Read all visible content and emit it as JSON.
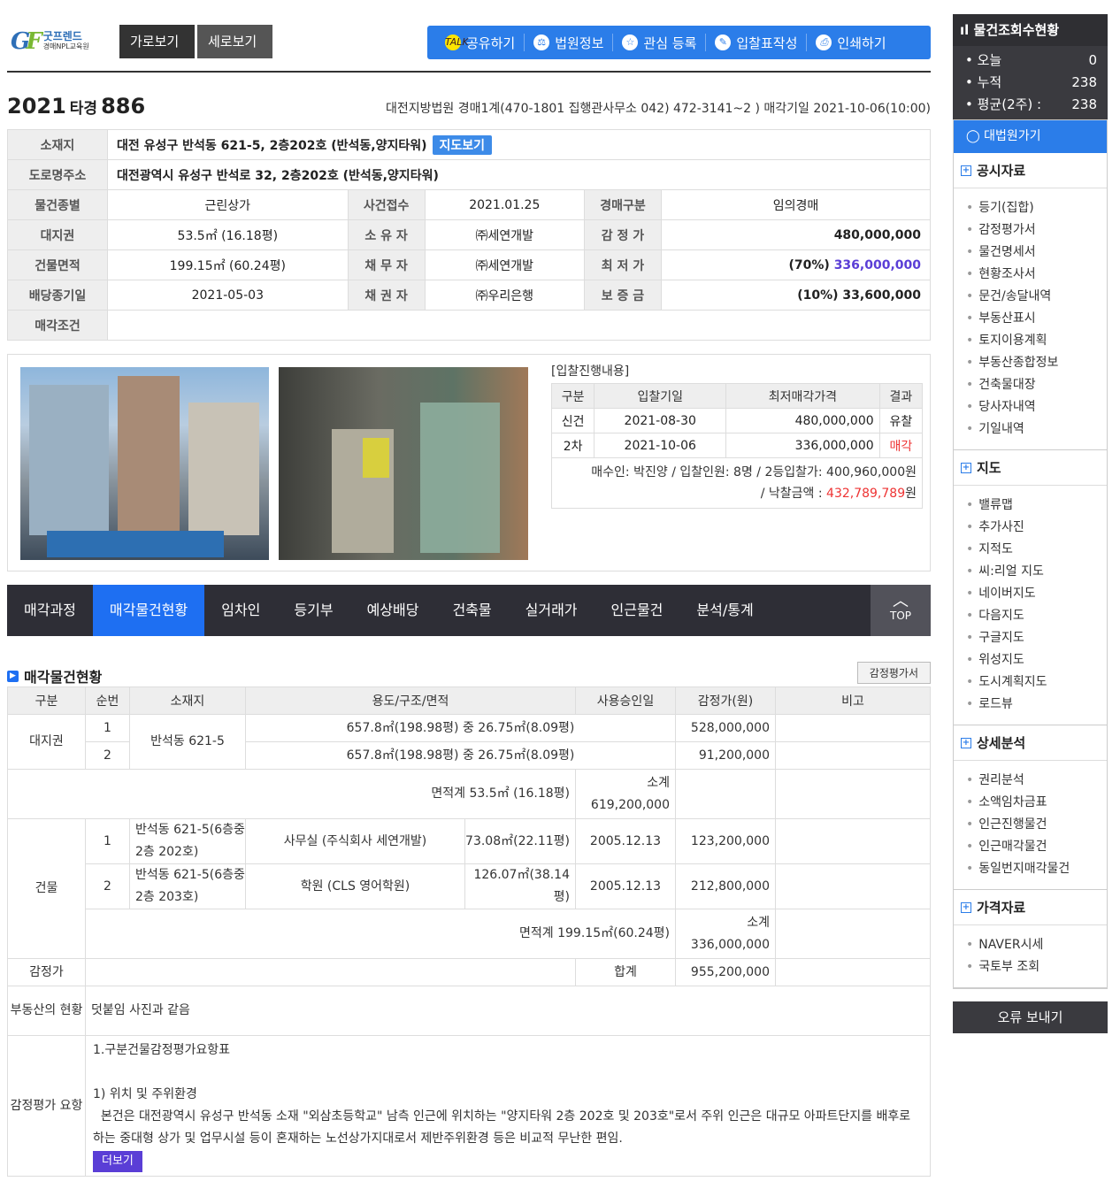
{
  "logo": {
    "brand": "굿프렌드",
    "sub": "경매NPL교육원"
  },
  "view": {
    "horizontal": "가로보기",
    "vertical": "세로보기"
  },
  "toolbar": [
    {
      "icon": "kakao-icon",
      "label": "공유하기"
    },
    {
      "icon": "court-icon",
      "label": "법원정보"
    },
    {
      "icon": "star-icon",
      "label": "관심 등록"
    },
    {
      "icon": "document-icon",
      "label": "입찰표작성"
    },
    {
      "icon": "printer-icon",
      "label": "인쇄하기"
    }
  ],
  "case": {
    "year": "2021",
    "type": "타경",
    "num": "886",
    "court": "대전지방법원 경매1계(470-1801 집행관사무소  042) 472-3141~2 ) 매각기일 2021-10-06(10:00)"
  },
  "info": {
    "addr_label": "소재지",
    "addr": "대전 유성구 반석동 621-5, 2층202호 (반석동,양지타워)",
    "map_btn": "지도보기",
    "road_label": "도로명주소",
    "road": "대전광역시 유성구 반석로 32, 2층202호 (반석동,양지타워)",
    "rows": [
      [
        "물건종별",
        "근린상가",
        "사건접수",
        "2021.01.25",
        "경매구분",
        "임의경매"
      ],
      [
        "대지권",
        "53.5㎡ (16.18평)",
        "소 유 자",
        "㈜세연개발",
        "감 정 가",
        "480,000,000"
      ],
      [
        "건물면적",
        "199.15㎡ (60.24평)",
        "채 무 자",
        "㈜세연개발",
        "최 저 가",
        ""
      ],
      [
        "배당종기일",
        "2021-05-03",
        "채 권 자",
        "㈜우리은행",
        "보 증 금",
        "(10%) 33,600,000"
      ]
    ],
    "min_pct": "(70%)",
    "min_val": "336,000,000",
    "cond_label": "매각조건",
    "cond": ""
  },
  "bid": {
    "title": "[입찰진행내용]",
    "headers": [
      "구분",
      "입찰기일",
      "최저매각가격",
      "결과"
    ],
    "rows": [
      [
        "신건",
        "2021-08-30",
        "480,000,000",
        "유찰"
      ],
      [
        "2차",
        "2021-10-06",
        "336,000,000",
        "매각"
      ]
    ],
    "summary1": "매수인: 박진양 / 입찰인원: 8명 / 2등입찰가: 400,960,000원",
    "summary2a": "/ 낙찰금액 : ",
    "summary2b": "432,789,789",
    "summary2c": "원"
  },
  "tabs": [
    "매각과정",
    "매각물건현황",
    "임차인",
    "등기부",
    "예상배당",
    "건축물",
    "실거래가",
    "인근물건",
    "분석/통계"
  ],
  "top_label": "TOP",
  "items": {
    "title": "매각물건현황",
    "appraisal_btn": "감정평가서",
    "headers": [
      "구분",
      "순번",
      "소재지",
      "용도/구조/면적",
      "사용승인일",
      "감정가(원)",
      "비고"
    ],
    "land_label": "대지권",
    "land_loc": "반석동 621-5",
    "land_rows": [
      [
        "1",
        "657.8㎡(198.98평) 중 26.75㎡(8.09평)",
        "528,000,000"
      ],
      [
        "2",
        "657.8㎡(198.98평) 중 26.75㎡(8.09평)",
        "91,200,000"
      ]
    ],
    "land_total": "면적계 53.5㎡ (16.18평)",
    "land_sub": "소계 619,200,000",
    "bldg_label": "건물",
    "bldg_rows": [
      [
        "1",
        "반석동 621-5(6층중2층 202호)",
        "사무실 (주식회사 세연개발)",
        "73.08㎡(22.11평)",
        "2005.12.13",
        "123,200,000"
      ],
      [
        "2",
        "반석동 621-5(6층중2층 203호)",
        "학원 (CLS 영어학원)",
        "126.07㎡(38.14평)",
        "2005.12.13",
        "212,800,000"
      ]
    ],
    "bldg_total": "면적계 199.15㎡(60.24평)",
    "bldg_sub": "소계 336,000,000",
    "appr_label": "감정가",
    "sum_label": "합계",
    "sum": "955,200,000",
    "status_label": "부동산의 현황",
    "status": "덧붙임 사진과 같음",
    "summary_label": "감정평가 요항",
    "summary_l1": "1.구분건물감정평가요항표",
    "summary_l2": "1) 위치 및 주위환경",
    "summary_l3": "  본건은 대전광역시 유성구 반석동 소재 \"외삼초등학교\" 남측 인근에 위치하는 \"양지타워 2층 202호 및 203호\"로서 주위 인근은 대규모 아파트단지를 배후로 하는 중대형 상가 및 업무시설 등이 혼재하는 노선상가지대로서 제반주위환경 등은 비교적 무난한 편임.",
    "more": "더보기"
  },
  "side": {
    "stat_title": "물건조회수현황",
    "stats": [
      [
        "오늘",
        "0"
      ],
      [
        "누적",
        "238"
      ],
      [
        "평균(2주) :",
        "238"
      ]
    ],
    "court": "대법원가기",
    "groups": [
      {
        "title": "공시자료",
        "items": [
          "등기(집합)",
          "감정평가서",
          "물건명세서",
          "현황조사서",
          "문건/송달내역",
          "부동산표시",
          "토지이용계획",
          "부동산종합정보",
          "건축물대장",
          "당사자내역",
          "기일내역"
        ]
      },
      {
        "title": "지도",
        "items": [
          "밸류맵",
          "추가사진",
          "지적도",
          "씨:리얼 지도",
          "네이버지도",
          "다음지도",
          "구글지도",
          "위성지도",
          "도시계획지도",
          "로드뷰"
        ]
      },
      {
        "title": "상세분석",
        "items": [
          "권리분석",
          "소액임차금표",
          "인근진행물건",
          "인근매각물건",
          "동일번지매각물건"
        ]
      },
      {
        "title": "가격자료",
        "items": [
          "NAVER시세",
          "국토부 조회"
        ]
      }
    ],
    "error": "오류 보내기"
  }
}
